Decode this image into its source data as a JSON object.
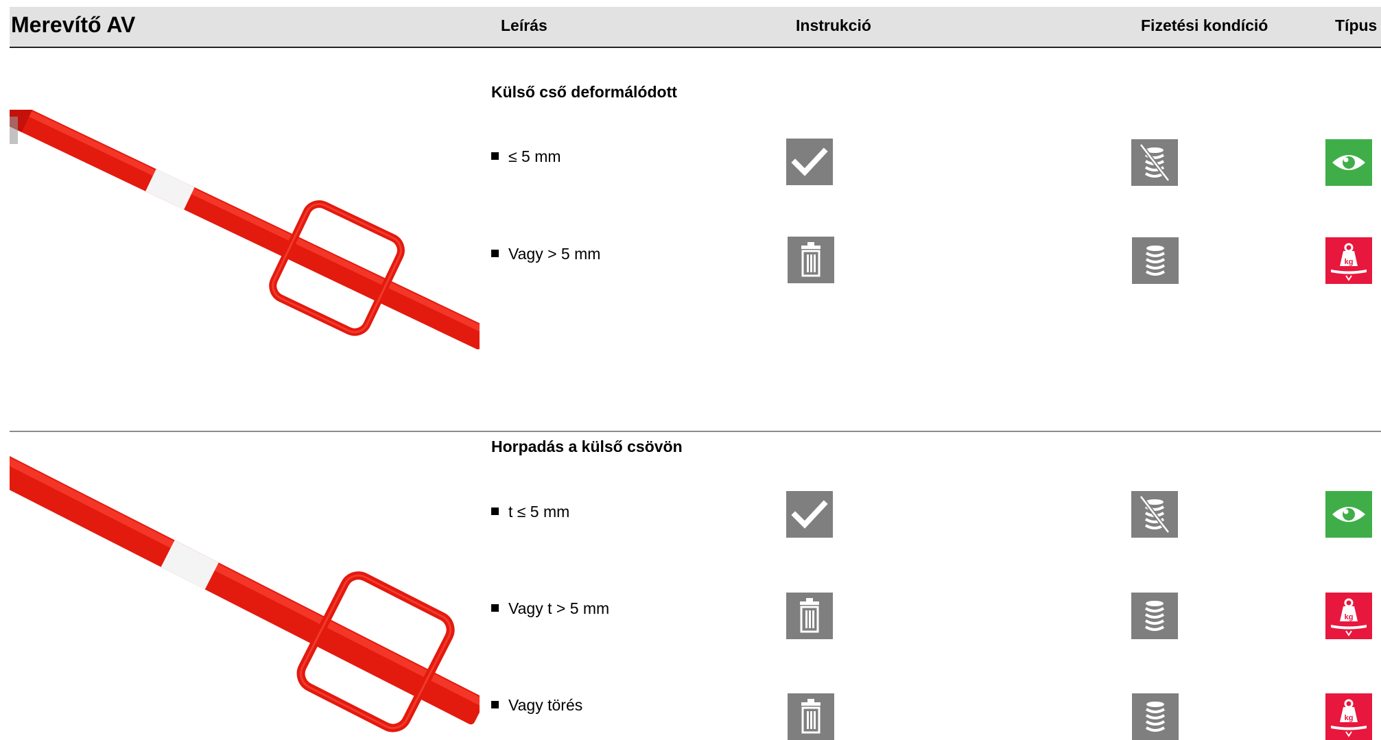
{
  "header": {
    "title": "Merevítő AV",
    "col_description": "Leírás",
    "col_instruction": "Instrukció",
    "col_payment": "Fizetési kondíció",
    "col_type": "Típus"
  },
  "sections": [
    {
      "title": "Külső cső deformálódott",
      "rows": [
        {
          "label": "≤ 5 mm",
          "instruction_icon": "check-icon",
          "payment_icon": "no-coins-icon",
          "type_icon": "eye-icon"
        },
        {
          "label": "Vagy > 5 mm",
          "instruction_icon": "trash-icon",
          "payment_icon": "coins-icon",
          "type_icon": "weight-kg-icon"
        }
      ]
    },
    {
      "title": "Horpadás a külső csövön",
      "rows": [
        {
          "label": "t ≤ 5 mm",
          "instruction_icon": "check-icon",
          "payment_icon": "no-coins-icon",
          "type_icon": "eye-icon"
        },
        {
          "label": "Vagy t > 5 mm",
          "instruction_icon": "trash-icon",
          "payment_icon": "coins-icon",
          "type_icon": "weight-kg-icon"
        },
        {
          "label": "Vagy törés",
          "instruction_icon": "trash-icon",
          "payment_icon": "coins-icon",
          "type_icon": "weight-kg-icon"
        }
      ]
    }
  ],
  "colors": {
    "header_bg": "#e2e2e2",
    "icon_gray": "#7f7f7f",
    "icon_green": "#3fae49",
    "icon_red": "#e8173d",
    "prop_red": "#e31a0e"
  }
}
